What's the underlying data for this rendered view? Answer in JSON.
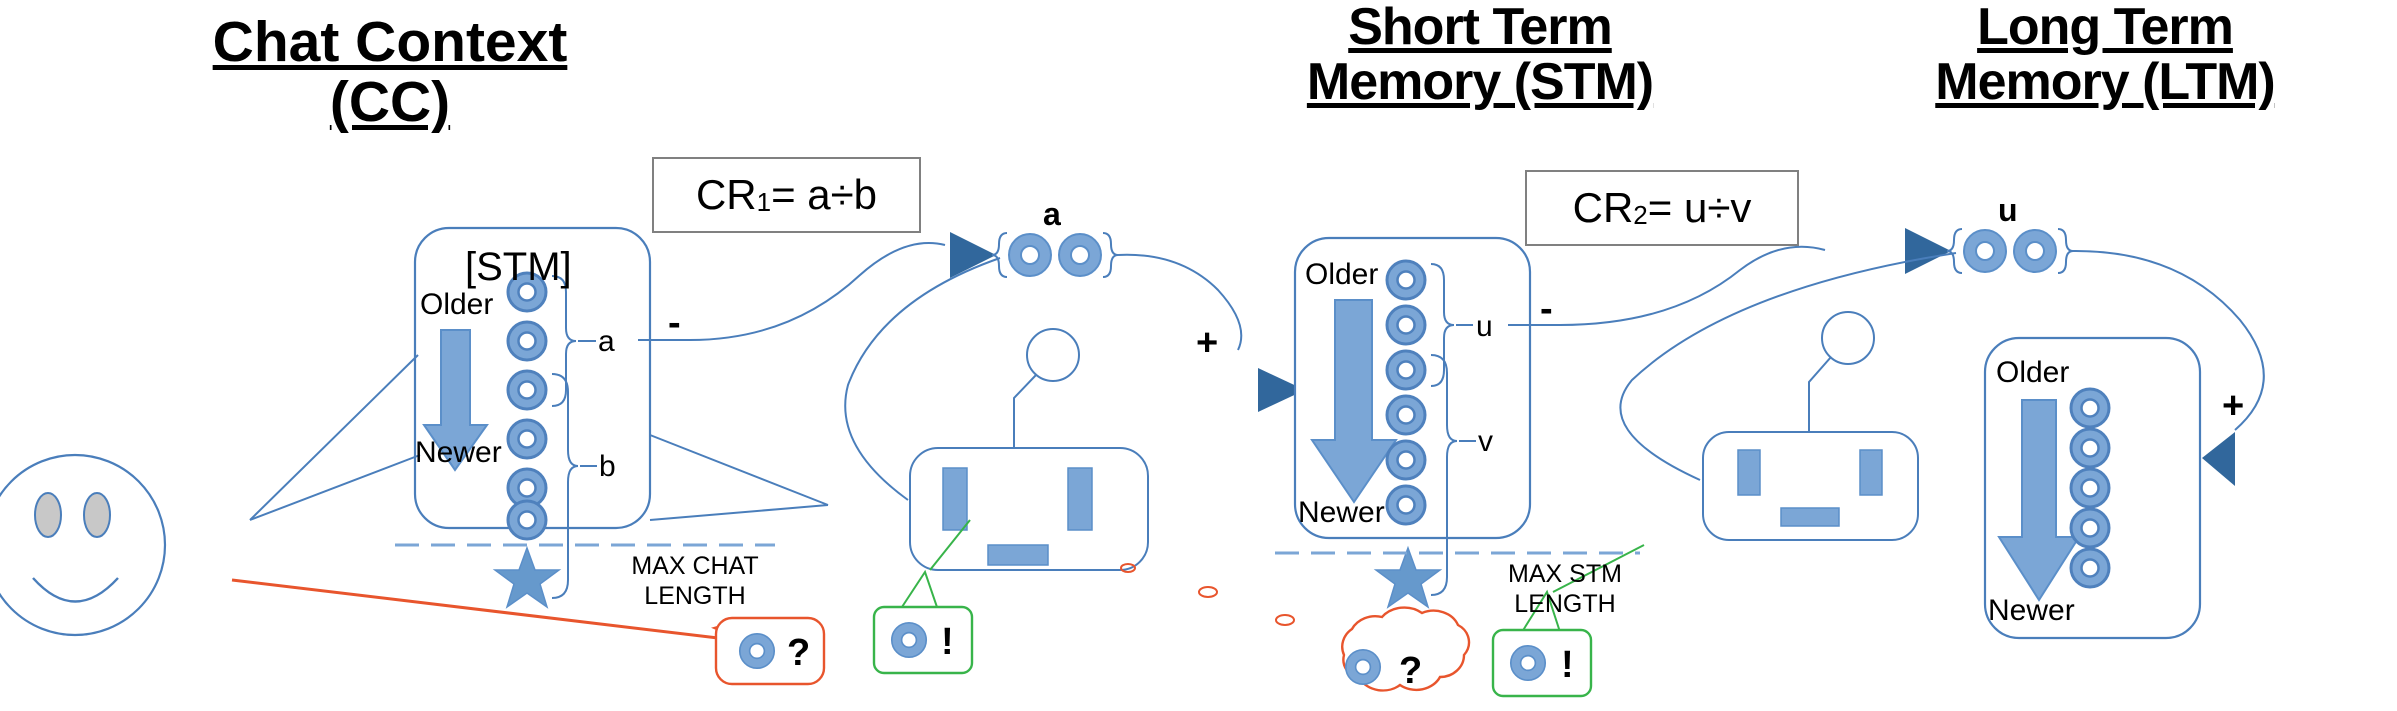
{
  "diagram": {
    "title_cc_line1": "Chat Context",
    "title_cc_line2": "(CC)",
    "title_stm_line1": "Short Term",
    "title_stm_line2": "Memory (STM)",
    "title_ltm_line1": "Long Term",
    "title_ltm_line2": "Memory (LTM)"
  },
  "formulas": {
    "cr1_prefix": "CR",
    "cr1_sub": "1",
    "cr1_body": " = a÷b",
    "cr2_prefix": "CR",
    "cr2_sub": "2",
    "cr2_body": " = u÷v"
  },
  "cc_box": {
    "tag": "[STM]",
    "older_label": "Older",
    "newer_label": "Newer",
    "group_top_label": "a",
    "group_bottom_label": "b",
    "ring_count": 6,
    "group_top_rings": 2,
    "group_bottom_rings": 4,
    "limit_label_line1": "MAX CHAT",
    "limit_label_line2": "LENGTH",
    "sign": "-"
  },
  "stm_box": {
    "older_label": "Older",
    "newer_label": "Newer",
    "group_top_label": "u",
    "group_bottom_label": "v",
    "ring_count": 6,
    "group_top_rings": 2,
    "group_bottom_rings": 4,
    "limit_label_line1": "MAX STM",
    "limit_label_line2": "LENGTH",
    "sign": "-",
    "inflow_sign": "+"
  },
  "ltm_box": {
    "older_label": "Older",
    "newer_label": "Newer",
    "ring_count": 5,
    "inflow_sign": "+"
  },
  "clusters": {
    "cluster_a_label": "a",
    "cluster_a_rings": 2,
    "cluster_u_label": "u",
    "cluster_u_rings": 2
  },
  "bubbles": {
    "cc_question": "?",
    "cc_answer": "!",
    "stm_question": "?",
    "stm_answer": "!"
  },
  "colors": {
    "ring_blue": "#4f81bd",
    "ring_fill": "#7ba6d6",
    "line_blue": "#4a7ebb",
    "arrow_blue": "#31679c",
    "question_orange": "#e8552d",
    "answer_green": "#38b44a",
    "box_gray": "#808080",
    "eye_gray": "#c8c8c8",
    "text_black": "#000000"
  }
}
